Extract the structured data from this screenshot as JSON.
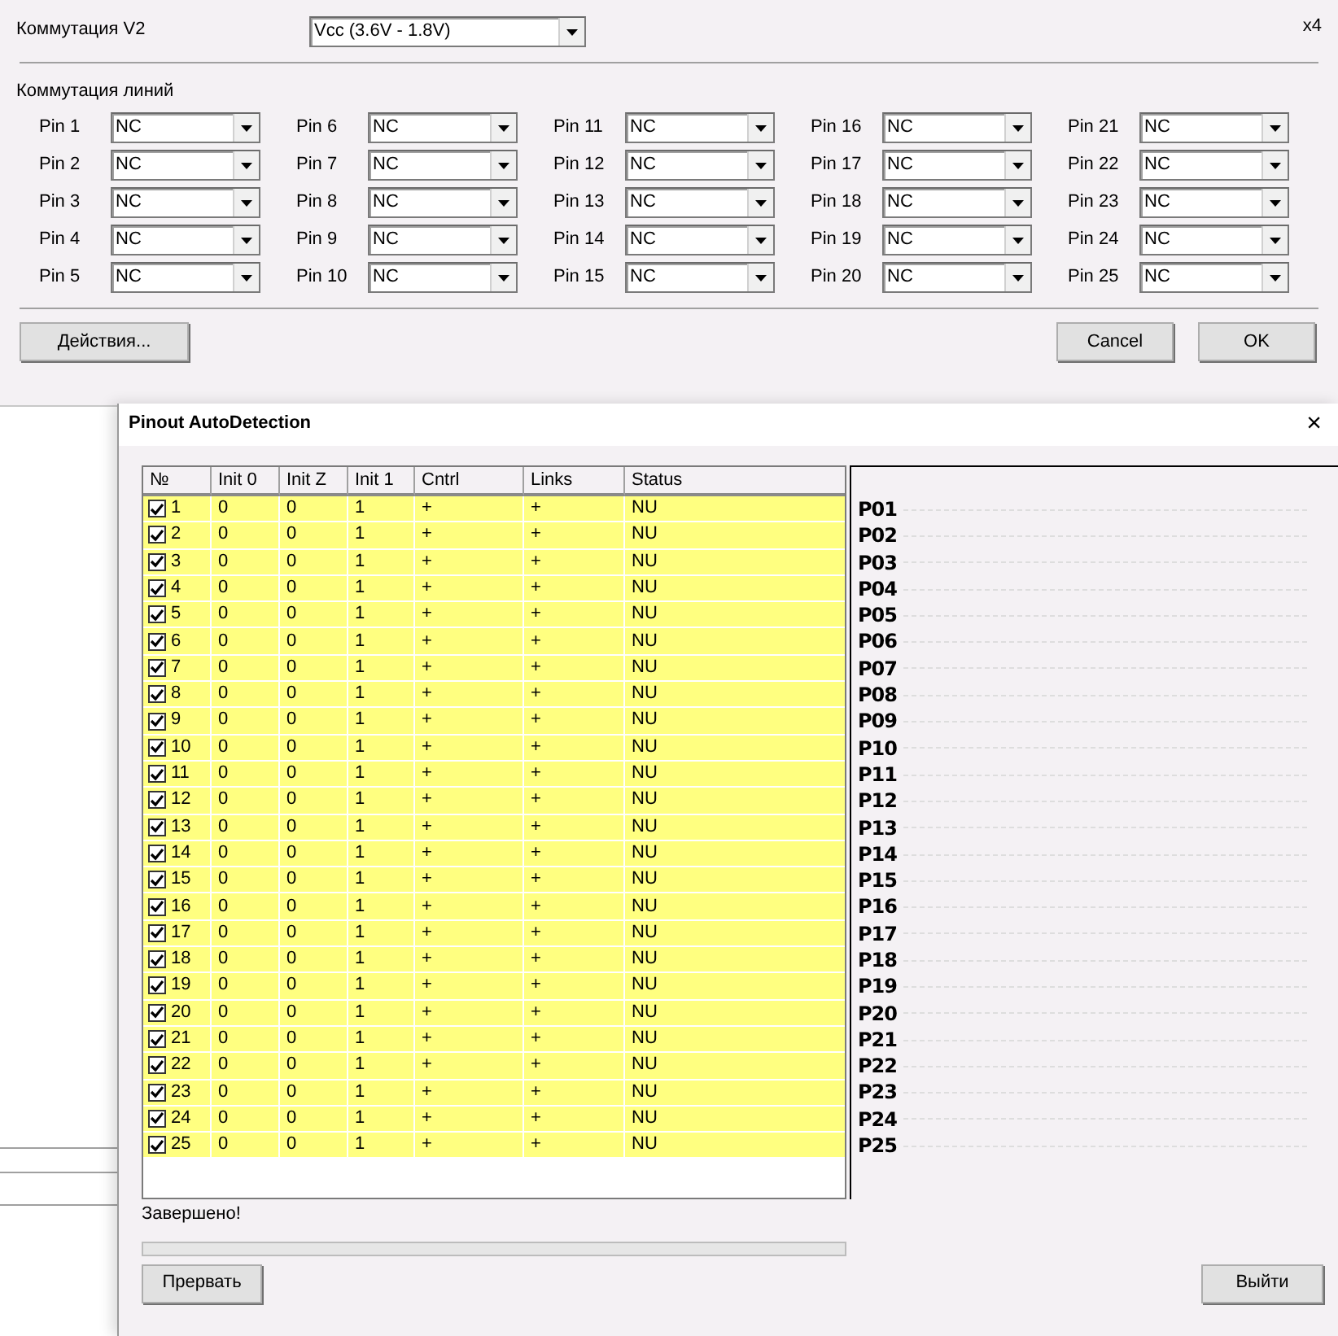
{
  "switch_dialog": {
    "title_label": "Коммутация V2",
    "vcc_select": {
      "value": "Vcc (3.6V - 1.8V)"
    },
    "multiplier": "x4",
    "section_label": "Коммутация линий",
    "pins": [
      {
        "label": "Pin 1",
        "value": "NC"
      },
      {
        "label": "Pin 2",
        "value": "NC"
      },
      {
        "label": "Pin 3",
        "value": "NC"
      },
      {
        "label": "Pin 4",
        "value": "NC"
      },
      {
        "label": "Pin 5",
        "value": "NC"
      },
      {
        "label": "Pin 6",
        "value": "NC"
      },
      {
        "label": "Pin 7",
        "value": "NC"
      },
      {
        "label": "Pin 8",
        "value": "NC"
      },
      {
        "label": "Pin 9",
        "value": "NC"
      },
      {
        "label": "Pin 10",
        "value": "NC"
      },
      {
        "label": "Pin 11",
        "value": "NC"
      },
      {
        "label": "Pin 12",
        "value": "NC"
      },
      {
        "label": "Pin 13",
        "value": "NC"
      },
      {
        "label": "Pin 14",
        "value": "NC"
      },
      {
        "label": "Pin 15",
        "value": "NC"
      },
      {
        "label": "Pin 16",
        "value": "NC"
      },
      {
        "label": "Pin 17",
        "value": "NC"
      },
      {
        "label": "Pin 18",
        "value": "NC"
      },
      {
        "label": "Pin 19",
        "value": "NC"
      },
      {
        "label": "Pin 20",
        "value": "NC"
      },
      {
        "label": "Pin 21",
        "value": "NC"
      },
      {
        "label": "Pin 22",
        "value": "NC"
      },
      {
        "label": "Pin 23",
        "value": "NC"
      },
      {
        "label": "Pin 24",
        "value": "NC"
      },
      {
        "label": "Pin 25",
        "value": "NC"
      }
    ],
    "actions_button": "Действия...",
    "buttons": [
      "Cancel",
      "OK"
    ]
  },
  "autodetect_dialog": {
    "title": "Pinout AutoDetection",
    "close": "×",
    "table": {
      "columns": [
        "№",
        "Init 0",
        "Init Z",
        "Init 1",
        "Cntrl",
        "Links",
        "Status"
      ],
      "rows": [
        {
          "checked": true,
          "cells": [
            "1",
            "0",
            "0",
            "1",
            "+",
            "+",
            "NU"
          ]
        },
        {
          "checked": true,
          "cells": [
            "2",
            "0",
            "0",
            "1",
            "+",
            "+",
            "NU"
          ]
        },
        {
          "checked": true,
          "cells": [
            "3",
            "0",
            "0",
            "1",
            "+",
            "+",
            "NU"
          ]
        },
        {
          "checked": true,
          "cells": [
            "4",
            "0",
            "0",
            "1",
            "+",
            "+",
            "NU"
          ]
        },
        {
          "checked": true,
          "cells": [
            "5",
            "0",
            "0",
            "1",
            "+",
            "+",
            "NU"
          ]
        },
        {
          "checked": true,
          "cells": [
            "6",
            "0",
            "0",
            "1",
            "+",
            "+",
            "NU"
          ]
        },
        {
          "checked": true,
          "cells": [
            "7",
            "0",
            "0",
            "1",
            "+",
            "+",
            "NU"
          ]
        },
        {
          "checked": true,
          "cells": [
            "8",
            "0",
            "0",
            "1",
            "+",
            "+",
            "NU"
          ]
        },
        {
          "checked": true,
          "cells": [
            "9",
            "0",
            "0",
            "1",
            "+",
            "+",
            "NU"
          ]
        },
        {
          "checked": true,
          "cells": [
            "10",
            "0",
            "0",
            "1",
            "+",
            "+",
            "NU"
          ]
        },
        {
          "checked": true,
          "cells": [
            "11",
            "0",
            "0",
            "1",
            "+",
            "+",
            "NU"
          ]
        },
        {
          "checked": true,
          "cells": [
            "12",
            "0",
            "0",
            "1",
            "+",
            "+",
            "NU"
          ]
        },
        {
          "checked": true,
          "cells": [
            "13",
            "0",
            "0",
            "1",
            "+",
            "+",
            "NU"
          ]
        },
        {
          "checked": true,
          "cells": [
            "14",
            "0",
            "0",
            "1",
            "+",
            "+",
            "NU"
          ]
        },
        {
          "checked": true,
          "cells": [
            "15",
            "0",
            "0",
            "1",
            "+",
            "+",
            "NU"
          ]
        },
        {
          "checked": true,
          "cells": [
            "16",
            "0",
            "0",
            "1",
            "+",
            "+",
            "NU"
          ]
        },
        {
          "checked": true,
          "cells": [
            "17",
            "0",
            "0",
            "1",
            "+",
            "+",
            "NU"
          ]
        },
        {
          "checked": true,
          "cells": [
            "18",
            "0",
            "0",
            "1",
            "+",
            "+",
            "NU"
          ]
        },
        {
          "checked": true,
          "cells": [
            "19",
            "0",
            "0",
            "1",
            "+",
            "+",
            "NU"
          ]
        },
        {
          "checked": true,
          "cells": [
            "20",
            "0",
            "0",
            "1",
            "+",
            "+",
            "NU"
          ]
        },
        {
          "checked": true,
          "cells": [
            "21",
            "0",
            "0",
            "1",
            "+",
            "+",
            "NU"
          ]
        },
        {
          "checked": true,
          "cells": [
            "22",
            "0",
            "0",
            "1",
            "+",
            "+",
            "NU"
          ]
        },
        {
          "checked": true,
          "cells": [
            "23",
            "0",
            "0",
            "1",
            "+",
            "+",
            "NU"
          ]
        },
        {
          "checked": true,
          "cells": [
            "24",
            "0",
            "0",
            "1",
            "+",
            "+",
            "NU"
          ]
        },
        {
          "checked": true,
          "cells": [
            "25",
            "0",
            "0",
            "1",
            "+",
            "+",
            "NU"
          ]
        }
      ]
    },
    "pin_labels": [
      "P01",
      "P02",
      "P03",
      "P04",
      "P05",
      "P06",
      "P07",
      "P08",
      "P09",
      "P10",
      "P11",
      "P12",
      "P13",
      "P14",
      "P15",
      "P16",
      "P17",
      "P18",
      "P19",
      "P20",
      "P21",
      "P22",
      "P23",
      "P24",
      "P25"
    ],
    "status_text": "Завершено!",
    "progress": {
      "level": 0
    },
    "abort_button": "Прервать",
    "exit_button": "Выйти"
  }
}
